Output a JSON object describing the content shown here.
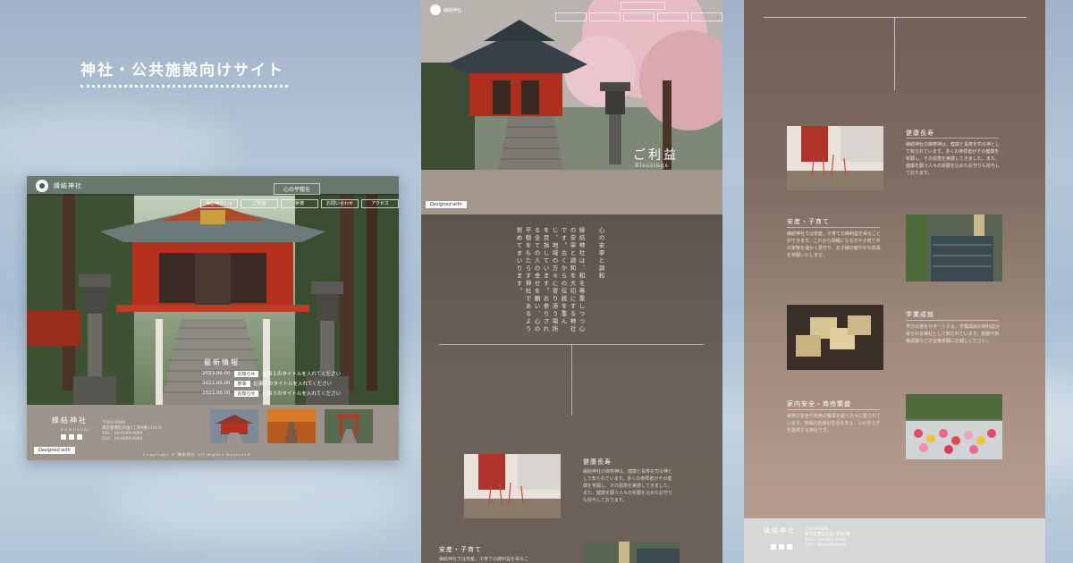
{
  "headline": {
    "text": "神社・公共施設向けサイト"
  },
  "desktop": {
    "logo_text": "縁結神社",
    "tagline": "心の平穏を",
    "nav": [
      "縁結神社とは",
      "ご利益",
      "祈祷",
      "お問い合わせ",
      "アクセス"
    ],
    "news": {
      "title": "最新情報",
      "rows": [
        {
          "date": "2023.00.00",
          "category": "お知らせ",
          "text": "記事１のタイトルを入れてください"
        },
        {
          "date": "2023.00.00",
          "category": "祭事",
          "text": "記事２のタイトルを入れてください"
        },
        {
          "date": "2023.00.00",
          "category": "お知らせ",
          "text": "記事３のタイトルを入れてください"
        }
      ]
    },
    "footer": {
      "name": "縁結神社",
      "sub": "ENMUSUBI",
      "address": [
        "〒000-0000",
        "東京都港区白金1丁目4番1111-0",
        "TEL：00-0000-0000",
        "FAX：00-0000-0000"
      ],
      "copyright": "Copyright © 縁結神社 All Rights Reserved"
    },
    "designed_badge": "Designed with"
  },
  "mobile": {
    "logo_text": "縁結神社",
    "hero_title": "ご利益",
    "hero_title_en": "Blessings",
    "designed_badge": "Designed with",
    "intro_heading": "心の安寧と調和",
    "intro_text": "縁結神社は、和を尊重しつつ心の安寧と調和を大切にする神社です。古くからの伝統を重んじ、地域の方々に寄り添う場所を目指しています。お参りされる全ての人の幸せを願い、心の平穏をもたらす神社であるよう努めてまいります。",
    "items": [
      {
        "heading": "健康長寿",
        "text": "縁結神社の御祭神は、健康と長寿を司る神として知られています。多くの参拝者がその健康を祈願し、その恩恵を実感してきました。また、健康を願う人々の祈願を込めたお守りも授与しております。"
      },
      {
        "heading": "安産・子育て",
        "text": "縁結神社では安産、子育ての御利益を得ることができます。"
      }
    ]
  },
  "longpage": {
    "items": [
      {
        "heading": "健康長寿",
        "text": "縁結神社の御祭神は、健康と長寿を司る神として知られています。多くの参拝者がその健康を祈願し、その恩恵を実感してきました。また、健康を願う人々の祈願を込めたお守りも授与しております。"
      },
      {
        "heading": "安産・子育て",
        "text": "縁結神社では安産、子育ての御利益を得ることができます。これから母親になる方や子育て中の家族を温かく見守り、お子様の健やかな成長を祈願いたします。"
      },
      {
        "heading": "学業成就",
        "text": "学びの道をサポートする、学業成就の御利益が得られる神社として知られています。受験や資格試験などの合格祈願にお越しください。"
      },
      {
        "heading": "家内安全・商売繁盛",
        "text": "家族の安全や商売の繁栄を願う方々に愛されています。地域の皆様の生活を支え、心の安らぎを提供する神社です。"
      }
    ],
    "footer": {
      "name": "縁結神社",
      "address": [
        "〒000-0000",
        "東京都港区白金1丁目4番",
        "TEL：00-0000-0000",
        "FAX：00-0000-0000"
      ]
    }
  }
}
